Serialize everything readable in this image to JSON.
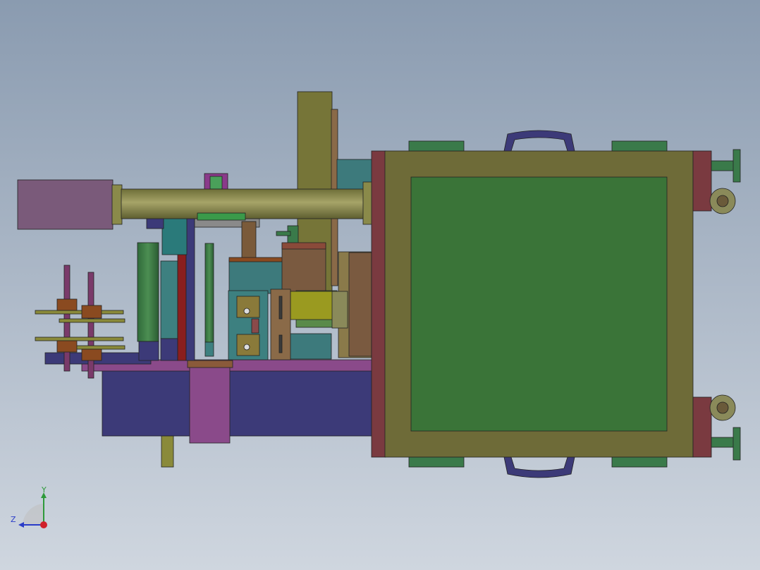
{
  "viewport": {
    "background_top": "#8a9bb0",
    "background_bottom": "#cfd6df"
  },
  "triad": {
    "y_label": "Y",
    "z_label": "Z",
    "y_color": "#2e9a3a",
    "z_color": "#2a3cc8",
    "x_color": "#d0202a"
  },
  "colors": {
    "frame_olive": "#6e6b38",
    "panel_green": "#3a7438",
    "base_indigo": "#3c3a78",
    "magenta": "#8a4a8a",
    "maroon": "#7a3a3a",
    "teal": "#3b7f80",
    "brown": "#7a5a3a",
    "rod_khaki": "#8a8a4a",
    "caster_green": "#3a7a4a"
  }
}
